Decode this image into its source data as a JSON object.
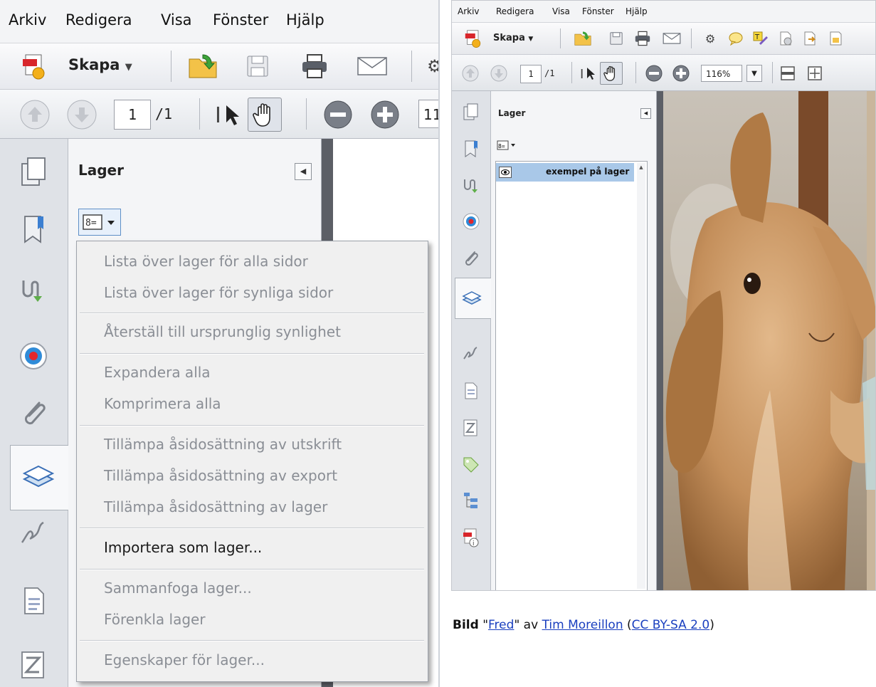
{
  "menubar": {
    "items": [
      "Arkiv",
      "Redigera",
      "Visa",
      "Fönster",
      "Hjälp"
    ]
  },
  "toolbar": {
    "create_label": "Skapa",
    "page_current": "1",
    "page_total": "/1",
    "zoom": "116%"
  },
  "layers_panel": {
    "title": "Lager",
    "layer_name": "exempel på lager"
  },
  "options_menu": {
    "items": [
      {
        "label": "Lista över lager för alla sidor",
        "enabled": false
      },
      {
        "label": "Lista över lager för synliga sidor",
        "enabled": false
      },
      {
        "label": "Återställ till ursprunglig synlighet",
        "enabled": false
      },
      {
        "label": "Expandera alla",
        "enabled": false
      },
      {
        "label": "Komprimera alla",
        "enabled": false
      },
      {
        "label": "Tillämpa åsidosättning av utskrift",
        "enabled": false
      },
      {
        "label": "Tillämpa åsidosättning av export",
        "enabled": false
      },
      {
        "label": "Tillämpa åsidosättning av lager",
        "enabled": false
      },
      {
        "label": "Importera som lager...",
        "enabled": true
      },
      {
        "label": "Sammanfoga lager...",
        "enabled": false
      },
      {
        "label": "Förenkla lager",
        "enabled": false
      },
      {
        "label": "Egenskaper för lager...",
        "enabled": false
      }
    ]
  },
  "caption": {
    "bold": "Bild",
    "q1": "\"",
    "title": "Fred",
    "q2": "\"",
    "by": " av ",
    "author": "Tim Moreillon",
    "lp": " (",
    "license": "CC BY-SA 2.0",
    "rp": ")"
  },
  "colors": {
    "selected_layer": "#a9c8e8",
    "link": "#1a3fbf",
    "disabled_text": "#8a8e95"
  }
}
